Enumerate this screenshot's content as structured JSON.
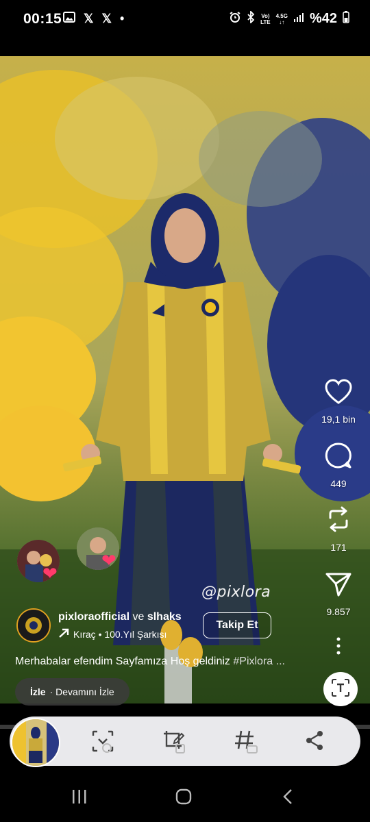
{
  "status_bar": {
    "time": "00:15",
    "left_icons": [
      "image-icon",
      "x-icon",
      "x-icon",
      "dot-icon"
    ],
    "net_top": "Vo)",
    "net_bottom": "LTE",
    "net2_top": "4.5G",
    "battery": "%42"
  },
  "reel": {
    "watermark": "@pixlora",
    "colors": {
      "yellow": "#f0c020",
      "navy": "#1c2a6a",
      "grass": "#2f5a1a"
    }
  },
  "actions": {
    "likes": "19,1 bin",
    "comments": "449",
    "reposts": "171",
    "shares": "9.857"
  },
  "author": {
    "name": "pixloraofficial",
    "conjunction": " ve ",
    "collab": "slhaks",
    "music": "Kıraç • 100.Yıl Şarkısı",
    "follow_label": "Takip Et"
  },
  "caption": {
    "text": "Merhabalar efendim Sayfamıza Hoş geldiniz ",
    "hashtag": "#Pixlora ..."
  },
  "watch_pill": {
    "bold": "İzle",
    "rest": "· Devamını İzle"
  },
  "toolbar": {
    "tools": [
      "scan-icon",
      "edit-crop-icon",
      "hashtag-icon",
      "share-icon"
    ]
  }
}
